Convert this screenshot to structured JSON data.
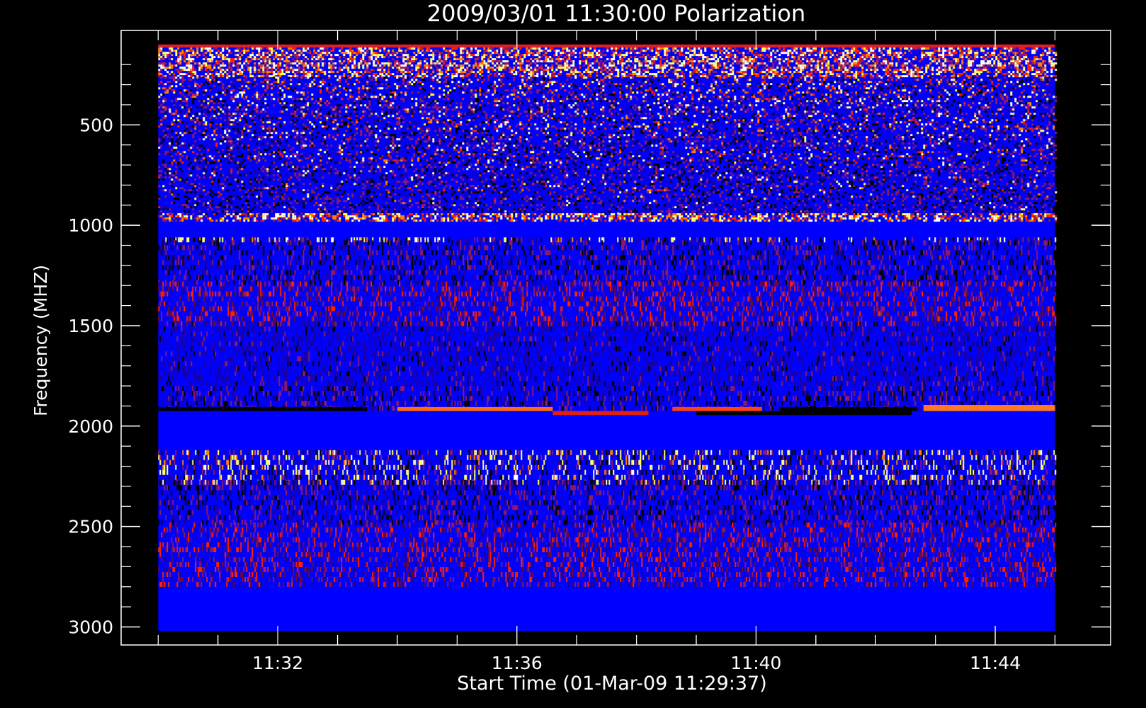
{
  "chart_data": {
    "type": "heatmap",
    "title": "2009/03/01 11:30:00 Polarization",
    "xlabel": "Start Time (01-Mar-09 11:29:37)",
    "ylabel": "Frequency (MHZ)",
    "x_start_minutes": 690.0,
    "x_end_minutes": 705.0,
    "x_axis_range_minutes": [
      689.38,
      705.93
    ],
    "x_major_ticks": [
      {
        "value": 692,
        "label": "11:32"
      },
      {
        "value": 696,
        "label": "11:36"
      },
      {
        "value": 700,
        "label": "11:40"
      },
      {
        "value": 704,
        "label": "11:44"
      }
    ],
    "y_reversed": true,
    "ylim": [
      3090,
      30
    ],
    "y_data_range": [
      100,
      3020
    ],
    "y_major_ticks": [
      {
        "value": 500,
        "label": "500"
      },
      {
        "value": 1000,
        "label": "1000"
      },
      {
        "value": 1500,
        "label": "1500"
      },
      {
        "value": 2000,
        "label": "2000"
      },
      {
        "value": 2500,
        "label": "2500"
      },
      {
        "value": 3000,
        "label": "3000"
      }
    ],
    "y_minor_ticks": [
      200,
      300,
      400,
      600,
      700,
      800,
      900,
      1100,
      1200,
      1300,
      1400,
      1600,
      1700,
      1800,
      1900,
      2100,
      2200,
      2300,
      2400,
      2600,
      2700,
      2800,
      2900
    ],
    "colormap": [
      "#000000",
      "#1a00a0",
      "#0000ff",
      "#8a1a6a",
      "#ff2000",
      "#ff8000",
      "#ffff60",
      "#ffffff"
    ],
    "background_color": "#0000ff",
    "bands": [
      {
        "from": 100,
        "to": 115,
        "kind": "edge-red"
      },
      {
        "from": 115,
        "to": 260,
        "kind": "noisy-hot"
      },
      {
        "from": 260,
        "to": 940,
        "kind": "noisy-mixed"
      },
      {
        "from": 940,
        "to": 975,
        "kind": "noisy-hot"
      },
      {
        "from": 975,
        "to": 1060,
        "kind": "blue-solid"
      },
      {
        "from": 1060,
        "to": 1075,
        "kind": "yellow-ticks"
      },
      {
        "from": 1075,
        "to": 1280,
        "kind": "striped-dark"
      },
      {
        "from": 1280,
        "to": 1480,
        "kind": "striped-red"
      },
      {
        "from": 1480,
        "to": 1800,
        "kind": "striped-blue"
      },
      {
        "from": 1800,
        "to": 1900,
        "kind": "striped-dark"
      },
      {
        "from": 2120,
        "to": 2270,
        "kind": "yellow-ticks"
      },
      {
        "from": 2270,
        "to": 2480,
        "kind": "striped-dark"
      },
      {
        "from": 2480,
        "to": 2780,
        "kind": "striped-red"
      },
      {
        "from": 2780,
        "to": 3020,
        "kind": "blue-solid"
      }
    ],
    "burst_segments": [
      {
        "t0": 690.0,
        "t1": 693.5,
        "y0": 1905,
        "y1": 1925,
        "color": "#000000"
      },
      {
        "t0": 694.0,
        "t1": 696.6,
        "y0": 1905,
        "y1": 1925,
        "color": "#ff6a10"
      },
      {
        "t0": 696.6,
        "t1": 698.2,
        "y0": 1925,
        "y1": 1945,
        "color": "#e02010"
      },
      {
        "t0": 698.6,
        "t1": 700.1,
        "y0": 1905,
        "y1": 1925,
        "color": "#ff4010"
      },
      {
        "t0": 699.0,
        "t1": 702.6,
        "y0": 1925,
        "y1": 1945,
        "color": "#000000"
      },
      {
        "t0": 700.4,
        "t1": 702.7,
        "y0": 1905,
        "y1": 1925,
        "color": "#000000"
      },
      {
        "t0": 702.8,
        "t1": 705.0,
        "y0": 1895,
        "y1": 1925,
        "color": "#ff7a20"
      }
    ]
  }
}
